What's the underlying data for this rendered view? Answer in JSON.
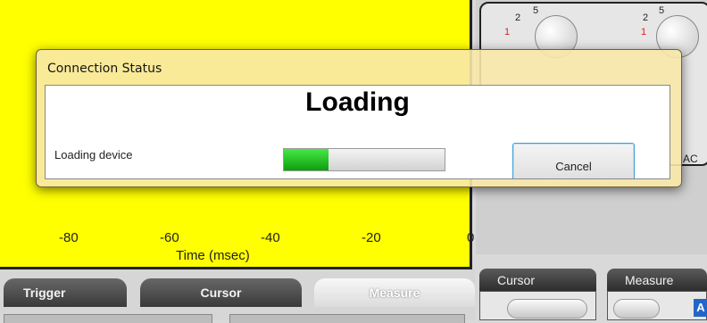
{
  "plot": {
    "x_ticks": [
      "-80",
      "-60",
      "-40",
      "-20",
      "0"
    ],
    "x_label": "Time (msec)"
  },
  "knobs": {
    "left": {
      "scale_top": "5",
      "scale_mid": "2",
      "scale_red": "1"
    },
    "right": {
      "scale_top": "5",
      "scale_mid": "2",
      "scale_red": "1"
    }
  },
  "coupling": {
    "label": "AC"
  },
  "tabs": [
    {
      "label": "Trigger",
      "active": false
    },
    {
      "label": "Cursor",
      "active": false
    },
    {
      "label": "Measure",
      "active": true
    }
  ],
  "panels": {
    "cursor": {
      "title": "Cursor"
    },
    "measure": {
      "title": "Measure",
      "partial_label": "A"
    }
  },
  "dialog": {
    "title": "Connection Status",
    "heading": "Loading",
    "message": "Loading device",
    "progress": 0.28,
    "cancel_label": "Cancel"
  },
  "colors": {
    "plot_background": "#ffff00",
    "dialog_frame": "#f8e8a8",
    "progress_fill": "#19b319",
    "button_focus": "#3c9fd6"
  }
}
